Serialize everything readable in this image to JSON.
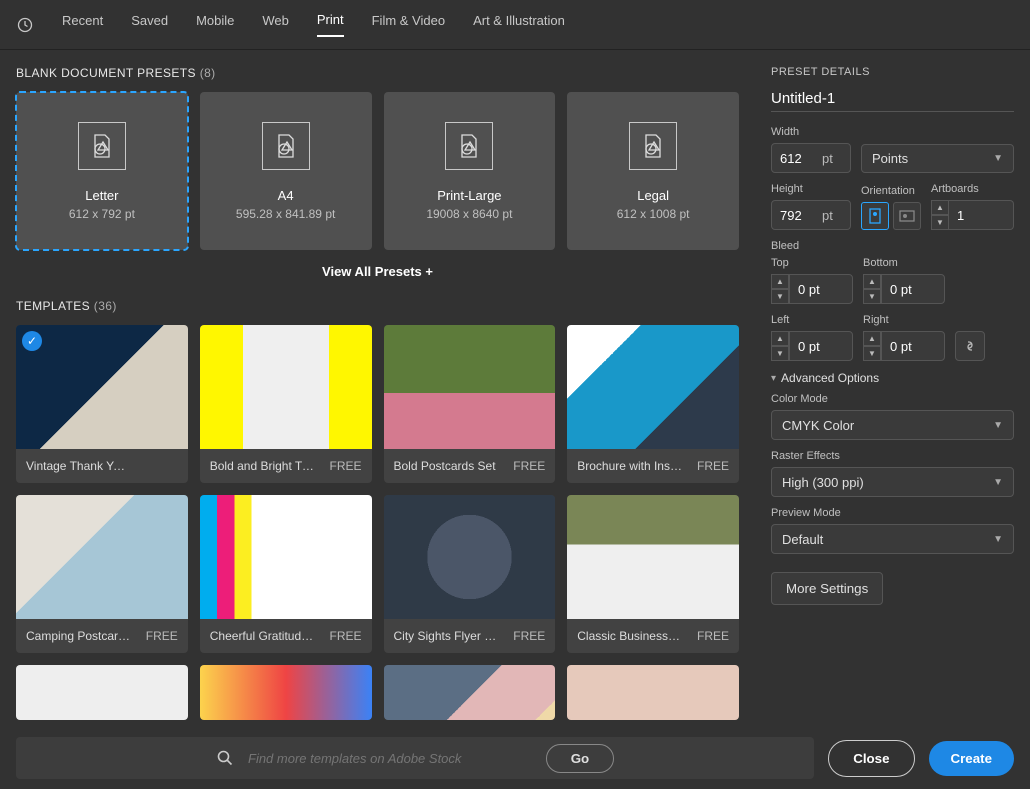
{
  "tabs": [
    "Recent",
    "Saved",
    "Mobile",
    "Web",
    "Print",
    "Film & Video",
    "Art & Illustration"
  ],
  "active_tab": 4,
  "blank_presets_heading": "BLANK DOCUMENT PRESETS",
  "blank_presets_count": "(8)",
  "presets": [
    {
      "name": "Letter",
      "dim": "612 x 792 pt"
    },
    {
      "name": "A4",
      "dim": "595.28 x 841.89 pt"
    },
    {
      "name": "Print-Large",
      "dim": "19008 x 8640 pt"
    },
    {
      "name": "Legal",
      "dim": "612 x 1008 pt"
    }
  ],
  "view_all": "View All Presets +",
  "templates_heading": "TEMPLATES",
  "templates_count": "(36)",
  "templates": [
    {
      "name": "Vintage Thank You Greeti…",
      "price": ""
    },
    {
      "name": "Bold and Bright Trifol…",
      "price": "FREE"
    },
    {
      "name": "Bold Postcards Set",
      "price": "FREE"
    },
    {
      "name": "Brochure with Instru…",
      "price": "FREE"
    },
    {
      "name": "Camping Postcards L…",
      "price": "FREE"
    },
    {
      "name": "Cheerful Gratitude C…",
      "price": "FREE"
    },
    {
      "name": "City Sights Flyer Set",
      "price": "FREE"
    },
    {
      "name": "Classic Business Car…",
      "price": "FREE"
    },
    {
      "name": "",
      "price": ""
    },
    {
      "name": "",
      "price": ""
    },
    {
      "name": "",
      "price": ""
    },
    {
      "name": "",
      "price": ""
    }
  ],
  "details": {
    "title": "PRESET DETAILS",
    "doc_name": "Untitled-1",
    "width_label": "Width",
    "width_value": "612",
    "width_unit": "pt",
    "units": "Points",
    "height_label": "Height",
    "height_value": "792",
    "height_unit": "pt",
    "orientation_label": "Orientation",
    "artboards_label": "Artboards",
    "artboards_value": "1",
    "bleed_label": "Bleed",
    "top_label": "Top",
    "top_value": "0 pt",
    "bottom_label": "Bottom",
    "bottom_value": "0 pt",
    "left_label": "Left",
    "left_value": "0 pt",
    "right_label": "Right",
    "right_value": "0 pt",
    "advanced": "Advanced Options",
    "color_mode_label": "Color Mode",
    "color_mode": "CMYK Color",
    "raster_label": "Raster Effects",
    "raster": "High (300 ppi)",
    "preview_label": "Preview Mode",
    "preview": "Default",
    "more": "More Settings"
  },
  "search_placeholder": "Find more templates on Adobe Stock",
  "go": "Go",
  "close": "Close",
  "create": "Create"
}
